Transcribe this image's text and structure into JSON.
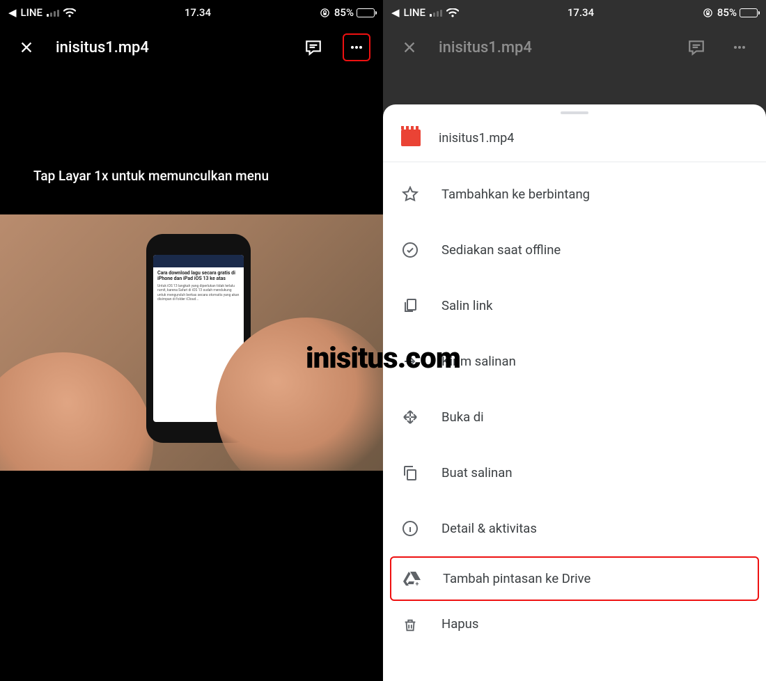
{
  "status": {
    "back_app": "LINE",
    "time": "17.34",
    "battery_pct": "85%"
  },
  "left": {
    "filename": "inisitus1.mp4",
    "caption": "Tap Layar 1x untuk memunculkan menu",
    "phone_headline": "Cara download lagu secara gratis di iPhone dan iPad iOS 13 ke atas"
  },
  "right": {
    "filename": "inisitus1.mp4",
    "sheet_filename": "inisitus1.mp4",
    "menu": {
      "star": "Tambahkan ke berbintang",
      "offline": "Sediakan saat offline",
      "copy_link": "Salin link",
      "send_copy": "Kirim salinan",
      "open_in": "Buka di",
      "make_copy": "Buat salinan",
      "details": "Detail & aktivitas",
      "add_shortcut": "Tambah pintasan ke Drive",
      "delete": "Hapus"
    }
  },
  "watermark": "inisitus.com"
}
